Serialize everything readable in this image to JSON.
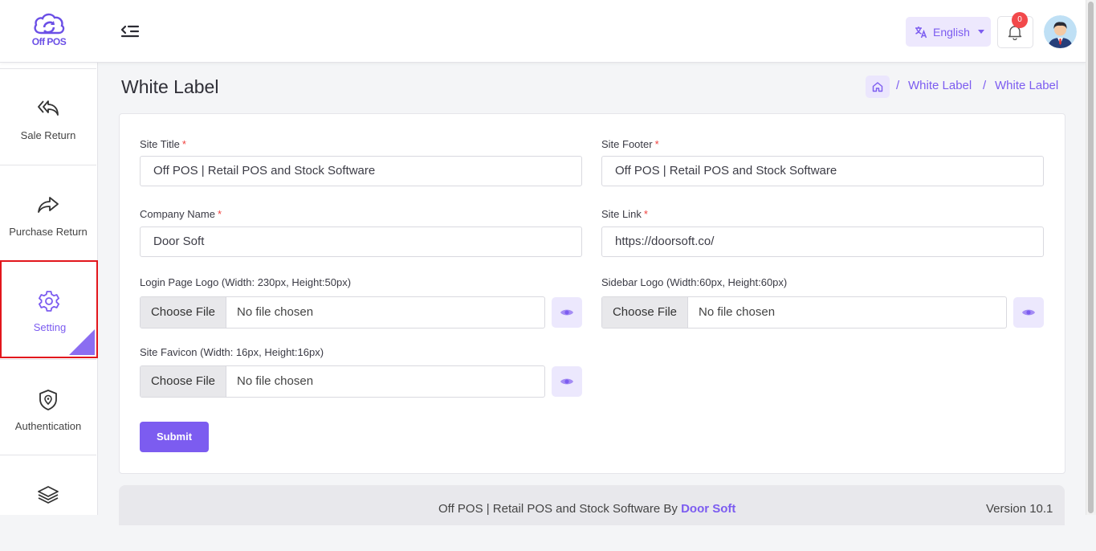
{
  "brand": {
    "logo_text": "Off POS"
  },
  "header": {
    "language": "English",
    "notification_count": "0"
  },
  "sidebar": {
    "items": [
      {
        "label": "Sale Return",
        "icon": "reply-all-icon"
      },
      {
        "label": "Purchase Return",
        "icon": "share-forward-icon"
      },
      {
        "label": "Setting",
        "icon": "gear-icon",
        "active": true
      },
      {
        "label": "Authentication",
        "icon": "shield-location-icon"
      },
      {
        "label": "",
        "icon": "layers-icon"
      }
    ]
  },
  "page": {
    "title": "White Label",
    "breadcrumb": [
      "White Label",
      "White Label"
    ]
  },
  "form": {
    "site_title": {
      "label": "Site Title",
      "required": "*",
      "value": "Off POS | Retail POS and Stock Software"
    },
    "site_footer": {
      "label": "Site Footer",
      "required": "*",
      "value": "Off POS | Retail POS and Stock Software"
    },
    "company_name": {
      "label": "Company Name",
      "required": "*",
      "value": "Door Soft"
    },
    "site_link": {
      "label": "Site Link",
      "required": "*",
      "value": "https://doorsoft.co/"
    },
    "login_logo": {
      "label": "Login Page Logo (Width: 230px, Height:50px)",
      "button": "Choose File",
      "status": "No file chosen"
    },
    "sidebar_logo": {
      "label": "Sidebar Logo (Width:60px, Height:60px)",
      "button": "Choose File",
      "status": "No file chosen"
    },
    "favicon": {
      "label": "Site Favicon (Width: 16px, Height:16px)",
      "button": "Choose File",
      "status": "No file chosen"
    },
    "submit": "Submit"
  },
  "footer": {
    "text": "Off POS | Retail POS and Stock Software By",
    "brand": "Door Soft",
    "version": "Version 10.1"
  },
  "colors": {
    "accent": "#7c5cf0",
    "accent_light": "#ede8fd",
    "required": "#f0423f",
    "badge": "#f2494b",
    "active_outline": "#e2161c"
  }
}
